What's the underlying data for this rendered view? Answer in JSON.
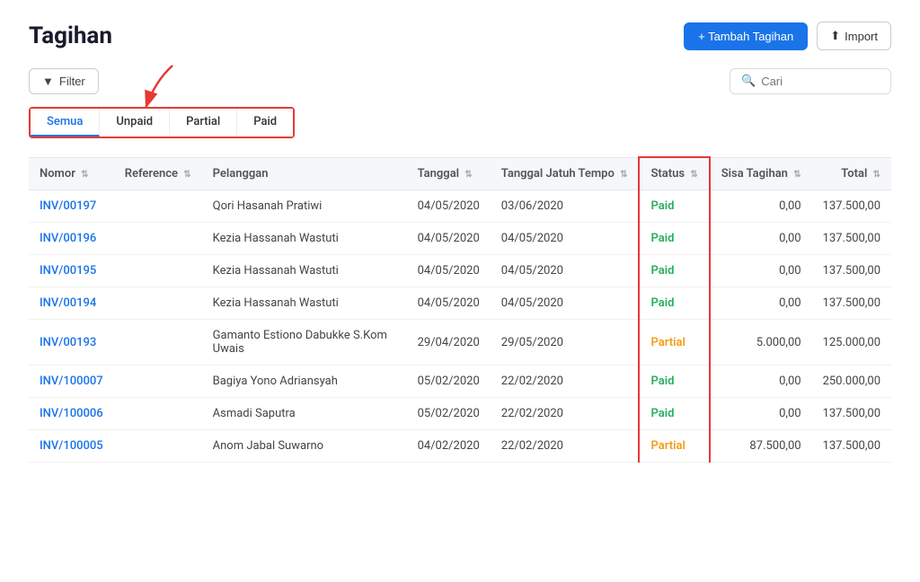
{
  "page": {
    "title": "Tagihan"
  },
  "header": {
    "add_button": "+ Tambah Tagihan",
    "import_button": "Import"
  },
  "toolbar": {
    "filter_label": "Filter",
    "search_placeholder": "Cari"
  },
  "tabs": [
    {
      "id": "semua",
      "label": "Semua",
      "active": true
    },
    {
      "id": "unpaid",
      "label": "Unpaid",
      "active": false
    },
    {
      "id": "partial",
      "label": "Partial",
      "active": false
    },
    {
      "id": "paid",
      "label": "Paid",
      "active": false
    }
  ],
  "table": {
    "columns": [
      {
        "id": "nomor",
        "label": "Nomor",
        "sortable": true
      },
      {
        "id": "reference",
        "label": "Reference",
        "sortable": true
      },
      {
        "id": "pelanggan",
        "label": "Pelanggan",
        "sortable": false
      },
      {
        "id": "tanggal",
        "label": "Tanggal",
        "sortable": true
      },
      {
        "id": "tanggal_jatuh_tempo",
        "label": "Tanggal Jatuh Tempo",
        "sortable": true
      },
      {
        "id": "status",
        "label": "Status",
        "sortable": true
      },
      {
        "id": "sisa_tagihan",
        "label": "Sisa Tagihan",
        "sortable": true
      },
      {
        "id": "total",
        "label": "Total",
        "sortable": true
      }
    ],
    "rows": [
      {
        "nomor": "INV/00197",
        "reference": "",
        "pelanggan": "Qori Hasanah Pratiwi",
        "tanggal": "04/05/2020",
        "tanggal_jatuh_tempo": "03/06/2020",
        "status": "Paid",
        "status_type": "paid",
        "sisa_tagihan": "0,00",
        "total": "137.500,00"
      },
      {
        "nomor": "INV/00196",
        "reference": "",
        "pelanggan": "Kezia Hassanah Wastuti",
        "tanggal": "04/05/2020",
        "tanggal_jatuh_tempo": "04/05/2020",
        "status": "Paid",
        "status_type": "paid",
        "sisa_tagihan": "0,00",
        "total": "137.500,00"
      },
      {
        "nomor": "INV/00195",
        "reference": "",
        "pelanggan": "Kezia Hassanah Wastuti",
        "tanggal": "04/05/2020",
        "tanggal_jatuh_tempo": "04/05/2020",
        "status": "Paid",
        "status_type": "paid",
        "sisa_tagihan": "0,00",
        "total": "137.500,00"
      },
      {
        "nomor": "INV/00194",
        "reference": "",
        "pelanggan": "Kezia Hassanah Wastuti",
        "tanggal": "04/05/2020",
        "tanggal_jatuh_tempo": "04/05/2020",
        "status": "Paid",
        "status_type": "paid",
        "sisa_tagihan": "0,00",
        "total": "137.500,00"
      },
      {
        "nomor": "INV/00193",
        "reference": "",
        "pelanggan": "Gamanto Estiono Dabukke S.Kom Uwais",
        "tanggal": "29/04/2020",
        "tanggal_jatuh_tempo": "29/05/2020",
        "status": "Partial",
        "status_type": "partial",
        "sisa_tagihan": "5.000,00",
        "total": "125.000,00"
      },
      {
        "nomor": "INV/100007",
        "reference": "",
        "pelanggan": "Bagiya Yono Adriansyah",
        "tanggal": "05/02/2020",
        "tanggal_jatuh_tempo": "22/02/2020",
        "status": "Paid",
        "status_type": "paid",
        "sisa_tagihan": "0,00",
        "total": "250.000,00"
      },
      {
        "nomor": "INV/100006",
        "reference": "",
        "pelanggan": "Asmadi Saputra",
        "tanggal": "05/02/2020",
        "tanggal_jatuh_tempo": "22/02/2020",
        "status": "Paid",
        "status_type": "paid",
        "sisa_tagihan": "0,00",
        "total": "137.500,00"
      },
      {
        "nomor": "INV/100005",
        "reference": "",
        "pelanggan": "Anom Jabal Suwarno",
        "tanggal": "04/02/2020",
        "tanggal_jatuh_tempo": "22/02/2020",
        "status": "Partial",
        "status_type": "partial",
        "sisa_tagihan": "87.500,00",
        "total": "137.500,00"
      }
    ]
  },
  "annotation": {
    "arrow_color": "#e53935"
  }
}
